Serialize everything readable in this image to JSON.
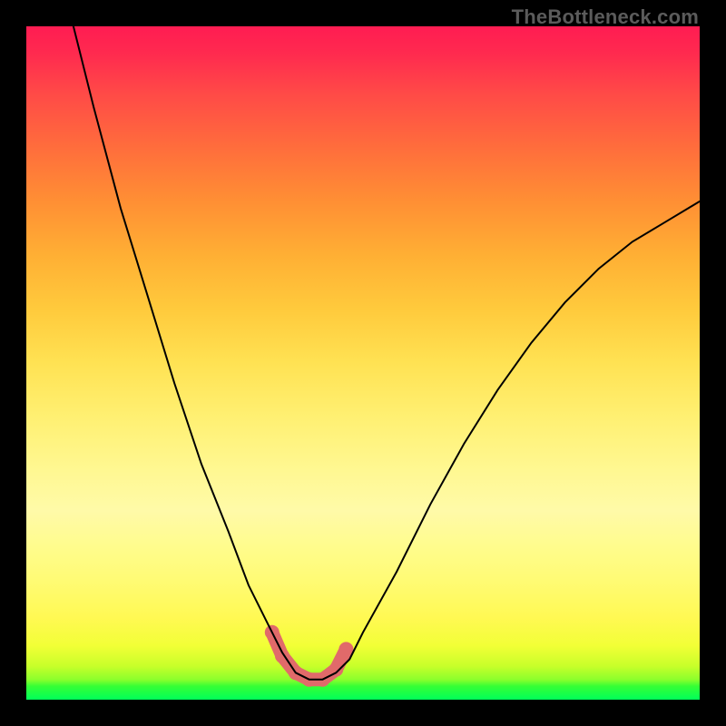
{
  "watermark": "TheBottleneck.com",
  "chart_data": {
    "type": "line",
    "title": "",
    "xlabel": "",
    "ylabel": "",
    "xlim": [
      0,
      100
    ],
    "ylim": [
      0,
      100
    ],
    "grid": false,
    "legend": false,
    "series": [
      {
        "name": "bottleneck-curve",
        "x": [
          7,
          10,
          14,
          18,
          22,
          26,
          30,
          33,
          36,
          38,
          40,
          42,
          44,
          46,
          48,
          50,
          55,
          60,
          65,
          70,
          75,
          80,
          85,
          90,
          95,
          100
        ],
        "y": [
          100,
          88,
          73,
          60,
          47,
          35,
          25,
          17,
          11,
          7,
          4,
          3,
          3,
          4,
          6,
          10,
          19,
          29,
          38,
          46,
          53,
          59,
          64,
          68,
          71,
          74
        ]
      }
    ],
    "highlight": {
      "name": "optimal-region",
      "x": [
        36.5,
        38,
        40,
        42,
        44,
        46,
        47.5
      ],
      "y": [
        10,
        6.5,
        4,
        3,
        3,
        4.5,
        7.5
      ]
    },
    "background_gradient": {
      "bottom_color": "#00ff5a",
      "mid_color": "#fff952",
      "top_color": "#ff1c52"
    }
  }
}
